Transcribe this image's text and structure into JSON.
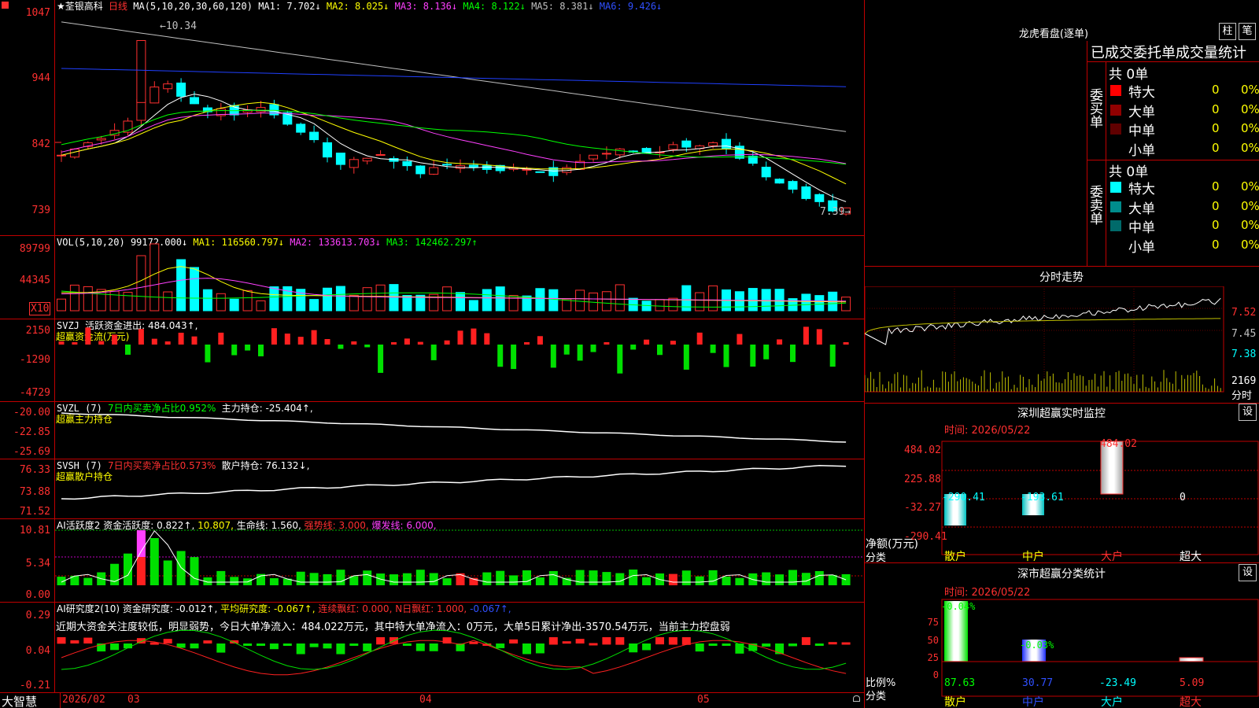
{
  "header": {
    "star_name": "★荃银高科",
    "period": "日线",
    "ma_params": "MA(5,10,20,30,60,120)",
    "ma1": "MA1: 7.702↓",
    "ma2": "MA2: 8.025↓",
    "ma3": "MA3: 8.136↓",
    "ma4": "MA4: 8.122↓",
    "ma5": "MA5: 8.381↓",
    "ma6": "MA6: 9.426↓"
  },
  "price_panel": {
    "y_labels": [
      "1047",
      "944",
      "842",
      "739"
    ],
    "high_label": "←10.34",
    "low_label": "7.39→"
  },
  "vol_panel": {
    "params": "VOL(5,10,20)",
    "vol": "99172.000↓",
    "ma1": "MA1: 116560.797↓",
    "ma2": "MA2: 133613.703↓",
    "ma3": "MA3: 142462.297↑",
    "y_labels": [
      "89799",
      "44345"
    ],
    "unit": "X10"
  },
  "svzj_panel": {
    "name": "SVZJ",
    "metric": "活跃资金进出: 484.043↑,",
    "sub": "超赢资金流(万元)",
    "y_labels": [
      "2150",
      "-1290",
      "-4729"
    ]
  },
  "svzl_panel": {
    "name": "SVZL (7)",
    "metric1": "7日内买卖净占比0.952%",
    "metric2": "主力持仓: -25.404↑,",
    "sub": "超赢主力持仓",
    "y_labels": [
      "-20.00",
      "-22.85",
      "-25.69"
    ]
  },
  "svsh_panel": {
    "name": "SVSH (7)",
    "metric1": "7日内买卖净占比0.573%",
    "metric2": "散户持仓: 76.132↓,",
    "sub": "超赢散户持仓",
    "y_labels": [
      "76.33",
      "73.88",
      "71.52"
    ]
  },
  "ai_active_panel": {
    "name": "AI活跃度2",
    "m1": "资金活跃度: 0.822↑,",
    "m2": "10.807,",
    "m3": "生命线: 1.560,",
    "m4": "强势线: 3.000,",
    "m5": "爆发线: 6.000,",
    "y_labels": [
      "10.81",
      "5.34",
      "0.00"
    ]
  },
  "ai_research_panel": {
    "name": "AI研究度2(10)",
    "m1": "资金研究度: -0.012↑,",
    "m2": "平均研究度: -0.067↑,",
    "m3": "连续飘红: 0.000,",
    "m4": "N日飘红: 1.000,",
    "m5": "-0.067↑,",
    "commentary": "近期大资金关注度较低，明显弱势，今日大单净流入：484.022万元，其中特大单净流入：0万元，大单5日累计净出-3570.54万元，当前主力控盘弱",
    "y_labels": [
      "0.29",
      "0.04",
      "-0.21"
    ]
  },
  "bottom_bar": {
    "logo": "大智慧",
    "dates": [
      "2026/02",
      "03",
      "04",
      "05"
    ]
  },
  "right_panel": {
    "longhu_title": "龙虎看盘(逐单)",
    "btn_bar": "柱",
    "btn_detail": "笔",
    "table_title": "已成交委托单成交量统计",
    "buy_side_label": "委买单",
    "sell_side_label": "委卖单",
    "buy_total": "共 0单",
    "sell_total": "共 0单",
    "buy_rows": [
      {
        "label": "特大",
        "count": "0",
        "pct": "0%",
        "color": "#ff0000"
      },
      {
        "label": "大单",
        "count": "0",
        "pct": "0%",
        "color": "#900000"
      },
      {
        "label": "中单",
        "count": "0",
        "pct": "0%",
        "color": "#600000"
      },
      {
        "label": "小单",
        "count": "0",
        "pct": "0%",
        "color": "#000000"
      }
    ],
    "sell_rows": [
      {
        "label": "特大",
        "count": "0",
        "pct": "0%",
        "color": "#00ffff"
      },
      {
        "label": "大单",
        "count": "0",
        "pct": "0%",
        "color": "#008c8c"
      },
      {
        "label": "中单",
        "count": "0",
        "pct": "0%",
        "color": "#006a6a"
      },
      {
        "label": "小单",
        "count": "0",
        "pct": "0%",
        "color": "#000000"
      }
    ],
    "intraday_title": "分时走势",
    "intraday_labels": [
      "7.52",
      "7.45",
      "7.38"
    ],
    "intraday_vol_label": "2169",
    "intraday_vol_unit": "分时",
    "monitor_title": "深圳超赢实时监控",
    "monitor_btn": "设",
    "monitor_time": "时间: 2026/05/22",
    "monitor_y": [
      "484.02",
      "225.88",
      "-32.27",
      "-290.41"
    ],
    "monitor_axis_label": "净额(万元)",
    "monitor_cat_label": "分类",
    "monitor_categories": [
      "散户",
      "中户",
      "大户",
      "超大"
    ],
    "monitor_values": [
      "-290.41",
      "-193.61",
      "484.02",
      "0"
    ],
    "class_title": "深市超赢分类统计",
    "class_btn": "设",
    "class_time": "时间: 2026/05/22",
    "class_y": [
      "75",
      "50",
      "25",
      "0"
    ],
    "class_axis_label": "比例%",
    "class_cat_label": "分类",
    "class_top_values": [
      "-0.04%",
      "-0.03%"
    ],
    "class_values": [
      "87.63",
      "30.77",
      "-23.49",
      "5.09"
    ],
    "class_categories": [
      "散户",
      "中户",
      "大户",
      "超大"
    ]
  }
}
